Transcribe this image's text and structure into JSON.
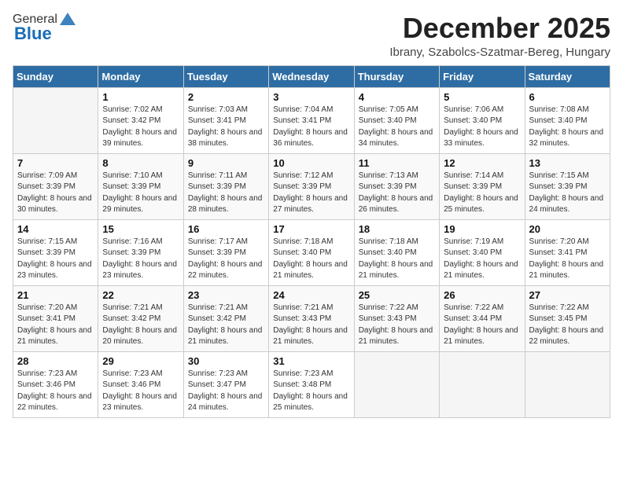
{
  "logo": {
    "general": "General",
    "blue": "Blue"
  },
  "header": {
    "month": "December 2025",
    "location": "Ibrany, Szabolcs-Szatmar-Bereg, Hungary"
  },
  "weekdays": [
    "Sunday",
    "Monday",
    "Tuesday",
    "Wednesday",
    "Thursday",
    "Friday",
    "Saturday"
  ],
  "weeks": [
    [
      {
        "day": "",
        "sunrise": "",
        "sunset": "",
        "daylight": ""
      },
      {
        "day": "1",
        "sunrise": "Sunrise: 7:02 AM",
        "sunset": "Sunset: 3:42 PM",
        "daylight": "Daylight: 8 hours and 39 minutes."
      },
      {
        "day": "2",
        "sunrise": "Sunrise: 7:03 AM",
        "sunset": "Sunset: 3:41 PM",
        "daylight": "Daylight: 8 hours and 38 minutes."
      },
      {
        "day": "3",
        "sunrise": "Sunrise: 7:04 AM",
        "sunset": "Sunset: 3:41 PM",
        "daylight": "Daylight: 8 hours and 36 minutes."
      },
      {
        "day": "4",
        "sunrise": "Sunrise: 7:05 AM",
        "sunset": "Sunset: 3:40 PM",
        "daylight": "Daylight: 8 hours and 34 minutes."
      },
      {
        "day": "5",
        "sunrise": "Sunrise: 7:06 AM",
        "sunset": "Sunset: 3:40 PM",
        "daylight": "Daylight: 8 hours and 33 minutes."
      },
      {
        "day": "6",
        "sunrise": "Sunrise: 7:08 AM",
        "sunset": "Sunset: 3:40 PM",
        "daylight": "Daylight: 8 hours and 32 minutes."
      }
    ],
    [
      {
        "day": "7",
        "sunrise": "Sunrise: 7:09 AM",
        "sunset": "Sunset: 3:39 PM",
        "daylight": "Daylight: 8 hours and 30 minutes."
      },
      {
        "day": "8",
        "sunrise": "Sunrise: 7:10 AM",
        "sunset": "Sunset: 3:39 PM",
        "daylight": "Daylight: 8 hours and 29 minutes."
      },
      {
        "day": "9",
        "sunrise": "Sunrise: 7:11 AM",
        "sunset": "Sunset: 3:39 PM",
        "daylight": "Daylight: 8 hours and 28 minutes."
      },
      {
        "day": "10",
        "sunrise": "Sunrise: 7:12 AM",
        "sunset": "Sunset: 3:39 PM",
        "daylight": "Daylight: 8 hours and 27 minutes."
      },
      {
        "day": "11",
        "sunrise": "Sunrise: 7:13 AM",
        "sunset": "Sunset: 3:39 PM",
        "daylight": "Daylight: 8 hours and 26 minutes."
      },
      {
        "day": "12",
        "sunrise": "Sunrise: 7:14 AM",
        "sunset": "Sunset: 3:39 PM",
        "daylight": "Daylight: 8 hours and 25 minutes."
      },
      {
        "day": "13",
        "sunrise": "Sunrise: 7:15 AM",
        "sunset": "Sunset: 3:39 PM",
        "daylight": "Daylight: 8 hours and 24 minutes."
      }
    ],
    [
      {
        "day": "14",
        "sunrise": "Sunrise: 7:15 AM",
        "sunset": "Sunset: 3:39 PM",
        "daylight": "Daylight: 8 hours and 23 minutes."
      },
      {
        "day": "15",
        "sunrise": "Sunrise: 7:16 AM",
        "sunset": "Sunset: 3:39 PM",
        "daylight": "Daylight: 8 hours and 23 minutes."
      },
      {
        "day": "16",
        "sunrise": "Sunrise: 7:17 AM",
        "sunset": "Sunset: 3:39 PM",
        "daylight": "Daylight: 8 hours and 22 minutes."
      },
      {
        "day": "17",
        "sunrise": "Sunrise: 7:18 AM",
        "sunset": "Sunset: 3:40 PM",
        "daylight": "Daylight: 8 hours and 21 minutes."
      },
      {
        "day": "18",
        "sunrise": "Sunrise: 7:18 AM",
        "sunset": "Sunset: 3:40 PM",
        "daylight": "Daylight: 8 hours and 21 minutes."
      },
      {
        "day": "19",
        "sunrise": "Sunrise: 7:19 AM",
        "sunset": "Sunset: 3:40 PM",
        "daylight": "Daylight: 8 hours and 21 minutes."
      },
      {
        "day": "20",
        "sunrise": "Sunrise: 7:20 AM",
        "sunset": "Sunset: 3:41 PM",
        "daylight": "Daylight: 8 hours and 21 minutes."
      }
    ],
    [
      {
        "day": "21",
        "sunrise": "Sunrise: 7:20 AM",
        "sunset": "Sunset: 3:41 PM",
        "daylight": "Daylight: 8 hours and 21 minutes."
      },
      {
        "day": "22",
        "sunrise": "Sunrise: 7:21 AM",
        "sunset": "Sunset: 3:42 PM",
        "daylight": "Daylight: 8 hours and 20 minutes."
      },
      {
        "day": "23",
        "sunrise": "Sunrise: 7:21 AM",
        "sunset": "Sunset: 3:42 PM",
        "daylight": "Daylight: 8 hours and 21 minutes."
      },
      {
        "day": "24",
        "sunrise": "Sunrise: 7:21 AM",
        "sunset": "Sunset: 3:43 PM",
        "daylight": "Daylight: 8 hours and 21 minutes."
      },
      {
        "day": "25",
        "sunrise": "Sunrise: 7:22 AM",
        "sunset": "Sunset: 3:43 PM",
        "daylight": "Daylight: 8 hours and 21 minutes."
      },
      {
        "day": "26",
        "sunrise": "Sunrise: 7:22 AM",
        "sunset": "Sunset: 3:44 PM",
        "daylight": "Daylight: 8 hours and 21 minutes."
      },
      {
        "day": "27",
        "sunrise": "Sunrise: 7:22 AM",
        "sunset": "Sunset: 3:45 PM",
        "daylight": "Daylight: 8 hours and 22 minutes."
      }
    ],
    [
      {
        "day": "28",
        "sunrise": "Sunrise: 7:23 AM",
        "sunset": "Sunset: 3:46 PM",
        "daylight": "Daylight: 8 hours and 22 minutes."
      },
      {
        "day": "29",
        "sunrise": "Sunrise: 7:23 AM",
        "sunset": "Sunset: 3:46 PM",
        "daylight": "Daylight: 8 hours and 23 minutes."
      },
      {
        "day": "30",
        "sunrise": "Sunrise: 7:23 AM",
        "sunset": "Sunset: 3:47 PM",
        "daylight": "Daylight: 8 hours and 24 minutes."
      },
      {
        "day": "31",
        "sunrise": "Sunrise: 7:23 AM",
        "sunset": "Sunset: 3:48 PM",
        "daylight": "Daylight: 8 hours and 25 minutes."
      },
      {
        "day": "",
        "sunrise": "",
        "sunset": "",
        "daylight": ""
      },
      {
        "day": "",
        "sunrise": "",
        "sunset": "",
        "daylight": ""
      },
      {
        "day": "",
        "sunrise": "",
        "sunset": "",
        "daylight": ""
      }
    ]
  ]
}
